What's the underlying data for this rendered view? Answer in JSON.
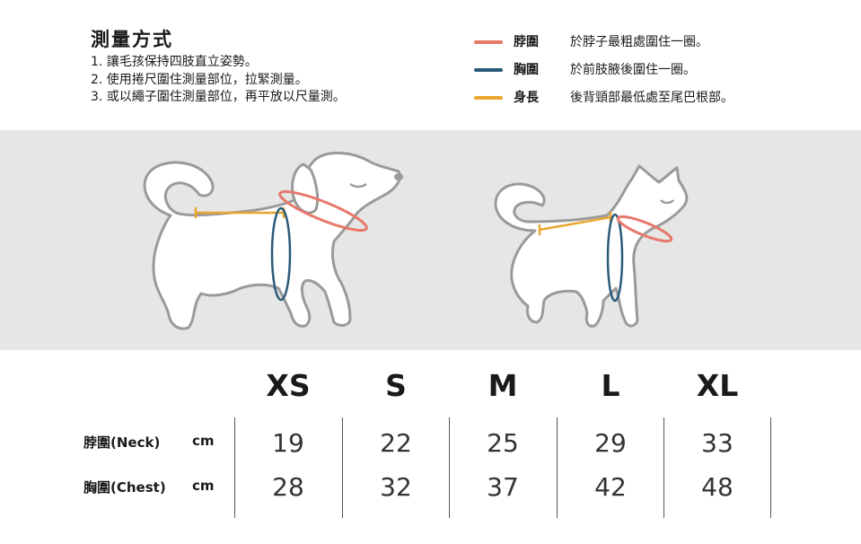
{
  "method": {
    "title": "測量方式",
    "steps": [
      "1.  讓毛孩保持四肢直立姿勢。",
      "2.  使用捲尺圍住測量部位，拉緊測量。",
      "3.  或以繩子圍住測量部位，再平放以尺量測。"
    ]
  },
  "legend": [
    {
      "name": "脖圍",
      "desc": "於脖子最粗處圍住一圈。",
      "color": "#e8786a"
    },
    {
      "name": "胸圍",
      "desc": "於前肢腋後圍住一圈。",
      "color": "#2b5a78"
    },
    {
      "name": "身長",
      "desc": "後背頸部最低處至尾巴根部。",
      "color": "#e8a62c"
    }
  ],
  "illustration": {
    "background": "#e6e6e6",
    "subjects": [
      "dog",
      "cat"
    ]
  },
  "size_table": {
    "sizes": [
      "XS",
      "S",
      "M",
      "L",
      "XL"
    ],
    "rows": [
      {
        "label": "脖圍(Neck)",
        "unit": "cm",
        "values": [
          "19",
          "22",
          "25",
          "29",
          "33"
        ]
      },
      {
        "label": "胸圍(Chest)",
        "unit": "cm",
        "values": [
          "28",
          "32",
          "37",
          "42",
          "48"
        ]
      }
    ]
  }
}
